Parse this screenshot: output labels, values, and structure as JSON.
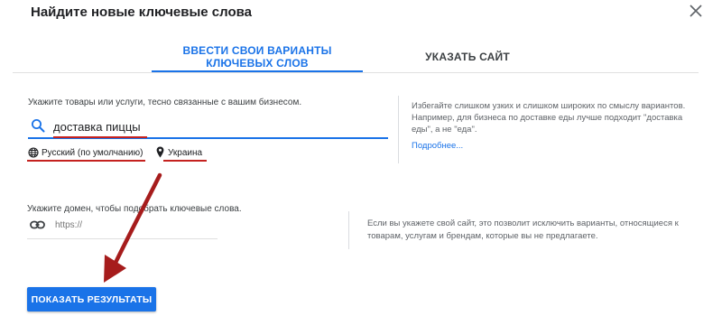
{
  "dialog": {
    "title": "Найдите новые ключевые слова"
  },
  "tabs": [
    {
      "label": "ВВЕСТИ СВОИ ВАРИАНТЫ КЛЮЧЕВЫХ СЛОВ",
      "active": true
    },
    {
      "label": "УКАЗАТЬ САЙТ",
      "active": false
    }
  ],
  "keywords": {
    "hint": "Укажите товары или услуги, тесно связанные с вашим бизнесом.",
    "value": "доставка пиццы",
    "language": "Русский (по умолчанию)",
    "location": "Украина",
    "side_text": "Избегайте слишком узких и слишком широких по смыслу вариантов. Например, для бизнеса по доставке еды лучше подходит \"доставка еды\", а не \"еда\".",
    "more_link": "Подробнее..."
  },
  "site": {
    "hint": "Укажите домен, чтобы подобрать ключевые слова.",
    "placeholder": "https://",
    "side_text": "Если вы укажете свой сайт, это позволит исключить варианты, относящиеся к товарам, услугам и брендам, которые вы не предлагаете."
  },
  "actions": {
    "show_results": "ПОКАЗАТЬ РЕЗУЛЬТАТЫ"
  },
  "icons": {
    "close": "close-icon",
    "search": "search-icon",
    "language": "globe-icon",
    "location": "location-pin-icon",
    "link": "link-icon"
  },
  "colors": {
    "accent": "#1a73e8",
    "annotation": "#c5221f",
    "arrow": "#a61c1c"
  }
}
